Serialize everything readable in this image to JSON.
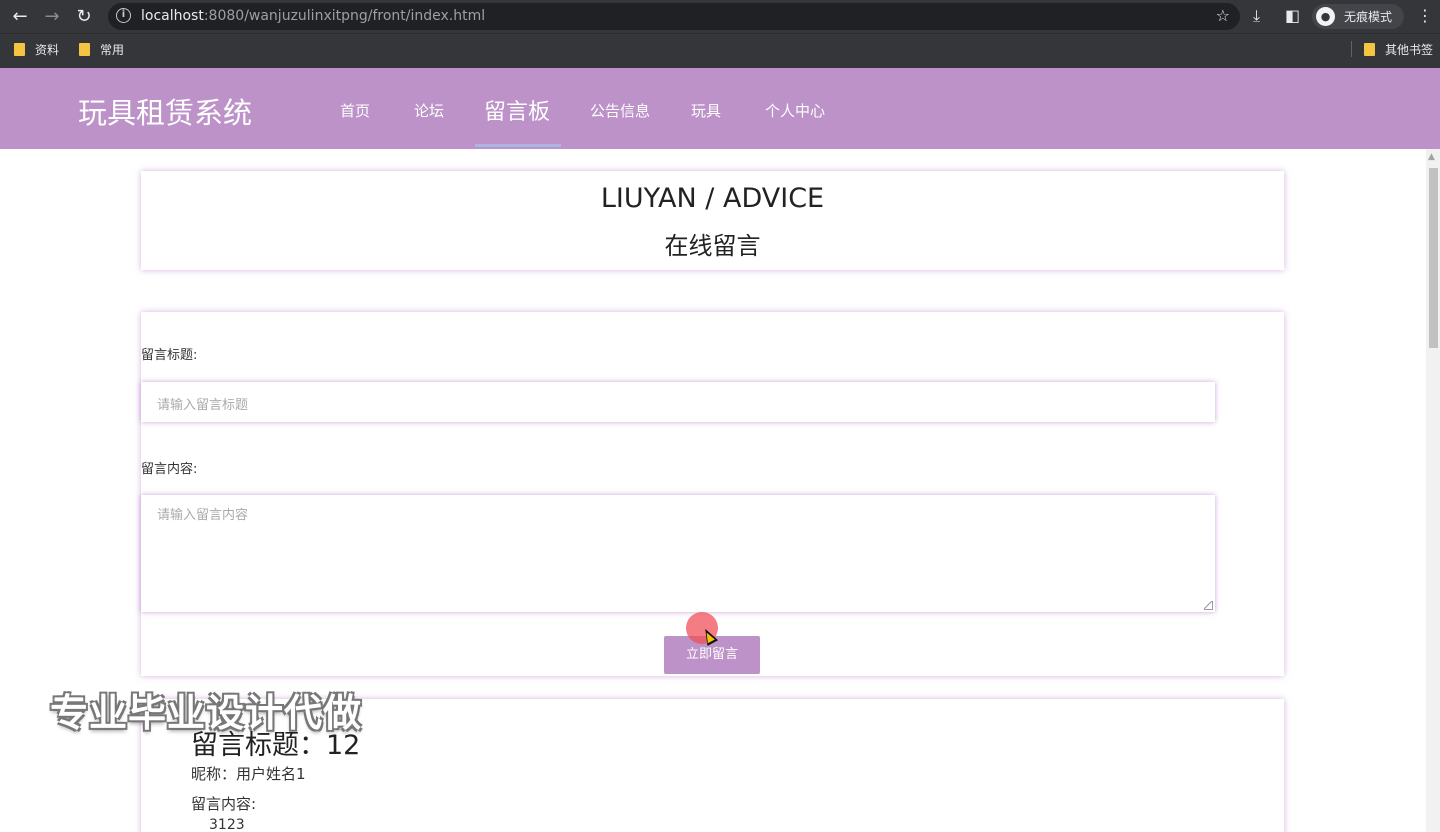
{
  "browser": {
    "url_host": "localhost",
    "url_rest": ":8080/wanjuzulinxitpng/front/index.html",
    "incognito_label": "无痕模式",
    "bookmarks": [
      "资料",
      "常用"
    ],
    "other_bookmarks": "其他书签"
  },
  "header": {
    "logo": "玩具租赁系统",
    "menu": [
      "首页",
      "论坛",
      "留言板",
      "公告信息",
      "玩具",
      "个人中心"
    ],
    "active_index": 2,
    "bg_color": "#bc92c8"
  },
  "title_card": {
    "en": "LIUYAN / ADVICE",
    "cn": "在线留言"
  },
  "form": {
    "title_label": "留言标题:",
    "title_placeholder": "请输入留言标题",
    "content_label": "留言内容:",
    "content_placeholder": "请输入留言内容",
    "submit_label": "立即留言"
  },
  "message": {
    "title": "留言标题：12",
    "nickname": "昵称：用户姓名1",
    "content_label": "留言内容:",
    "content": "3123"
  },
  "watermark": "专业毕业设计代做"
}
